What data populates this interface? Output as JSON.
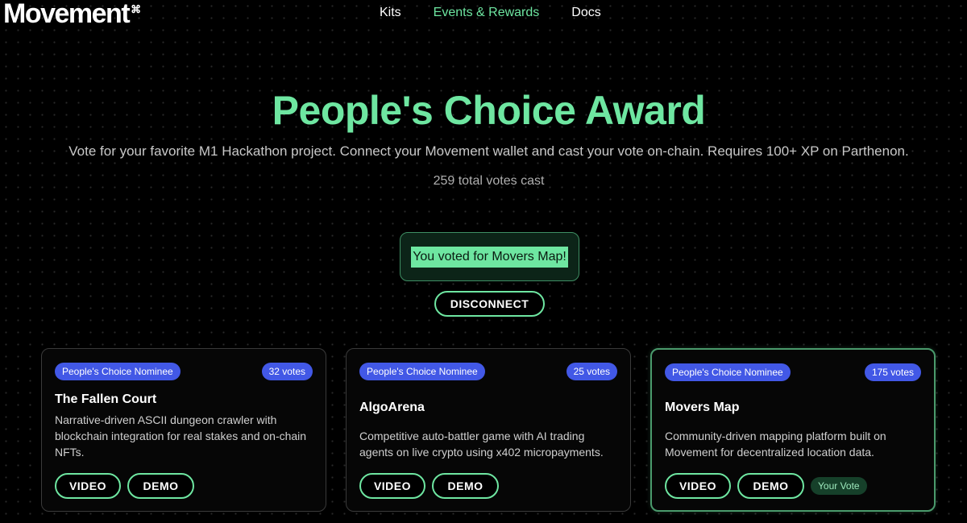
{
  "header": {
    "logo": "Movement",
    "logo_mark": "⌘",
    "nav": [
      {
        "label": "Kits",
        "active": false
      },
      {
        "label": "Events & Rewards",
        "active": true
      },
      {
        "label": "Docs",
        "active": false
      }
    ]
  },
  "hero": {
    "title": "People's Choice Award",
    "subtitle": "Vote for your favorite M1 Hackathon project. Connect your Movement wallet and cast your vote on-chain. Requires 100+ XP on Parthenon.",
    "total_votes": "259 total votes cast"
  },
  "vote_status": {
    "message": "You voted for Movers Map!",
    "disconnect_label": "DISCONNECT"
  },
  "projects": [
    {
      "badge": "People's Choice Nominee",
      "votes": "32 votes",
      "title": "The Fallen Court",
      "description": "Narrative-driven ASCII dungeon crawler with blockchain integration for real stakes and on-chain NFTs.",
      "video_label": "VIDEO",
      "demo_label": "DEMO"
    },
    {
      "badge": "People's Choice Nominee",
      "votes": "25 votes",
      "title": "AlgoArena",
      "description": "Competitive auto-battler game with AI trading agents on live crypto using x402 micropayments.",
      "video_label": "VIDEO",
      "demo_label": "DEMO"
    },
    {
      "badge": "People's Choice Nominee",
      "votes": "175 votes",
      "title": "Movers Map",
      "description": "Community-driven mapping platform built on Movement for decentralized location data.",
      "video_label": "VIDEO",
      "demo_label": "DEMO",
      "your_vote_label": "Your Vote"
    }
  ],
  "colors": {
    "accent": "#6ee6a1",
    "badge": "#4258e6",
    "background": "#000000"
  }
}
